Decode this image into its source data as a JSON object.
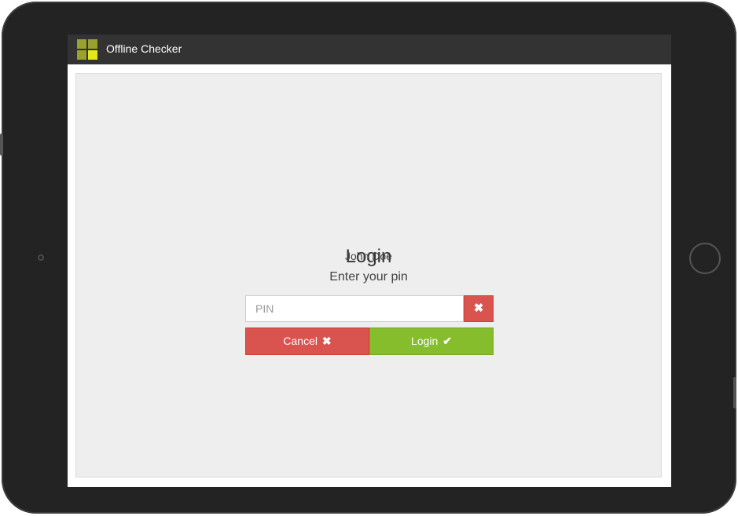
{
  "app": {
    "title": "Offline Checker",
    "logo_colors": [
      "#9aa12c",
      "#9aa12c",
      "#9aa12c",
      "#e3e71b"
    ]
  },
  "login": {
    "heading": "Login",
    "user_name": "John Doe",
    "prompt": "Enter your pin",
    "pin_placeholder": "PIN",
    "pin_value": "",
    "clear_icon": "✖",
    "cancel_label": "Cancel",
    "cancel_icon": "✖",
    "login_label": "Login",
    "login_icon": "✔"
  },
  "colors": {
    "header_bg": "#333333",
    "panel_bg": "#eeeeee",
    "danger": "#d9534f",
    "success": "#86bd2c"
  }
}
